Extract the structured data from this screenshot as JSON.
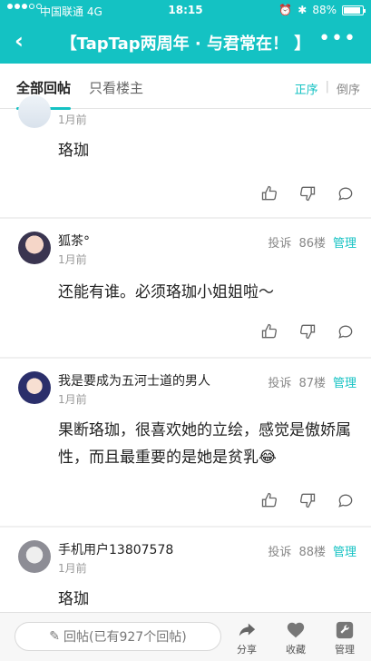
{
  "status_bar": {
    "carrier": "中国联通  4G",
    "time": "18:15",
    "battery": "88%",
    "battery_level": 0.88
  },
  "nav": {
    "title": "【TapTap两周年 · 与君常在！ 】"
  },
  "tabs": {
    "all": "全部回帖",
    "op_only": "只看楼主",
    "sort_asc": "正序",
    "sort_sep": "|",
    "sort_desc": "倒序"
  },
  "posts": [
    {
      "name": "",
      "time": "1月前",
      "report": "",
      "floor": "",
      "manage": "",
      "content": "珞珈"
    },
    {
      "name": "狐茶°",
      "time": "1月前",
      "report": "投诉",
      "floor": "86楼",
      "manage": "管理",
      "content": "还能有谁。必须珞珈小姐姐啦～"
    },
    {
      "name": "我是要成为五河士道的男人",
      "time": "1月前",
      "report": "投诉",
      "floor": "87楼",
      "manage": "管理",
      "content": "果断珞珈，很喜欢她的立绘，感觉是傲娇属性，而且最重要的是她是贫乳😂"
    },
    {
      "name": "手机用户13807578",
      "time": "1月前",
      "report": "投诉",
      "floor": "88楼",
      "manage": "管理",
      "content": "珞珈"
    }
  ],
  "bottom_bar": {
    "reply_label": "回帖(已有927个回帖)",
    "share": "分享",
    "favorite": "收藏",
    "manage": "管理"
  },
  "colors": {
    "accent": "#14c2c3"
  }
}
